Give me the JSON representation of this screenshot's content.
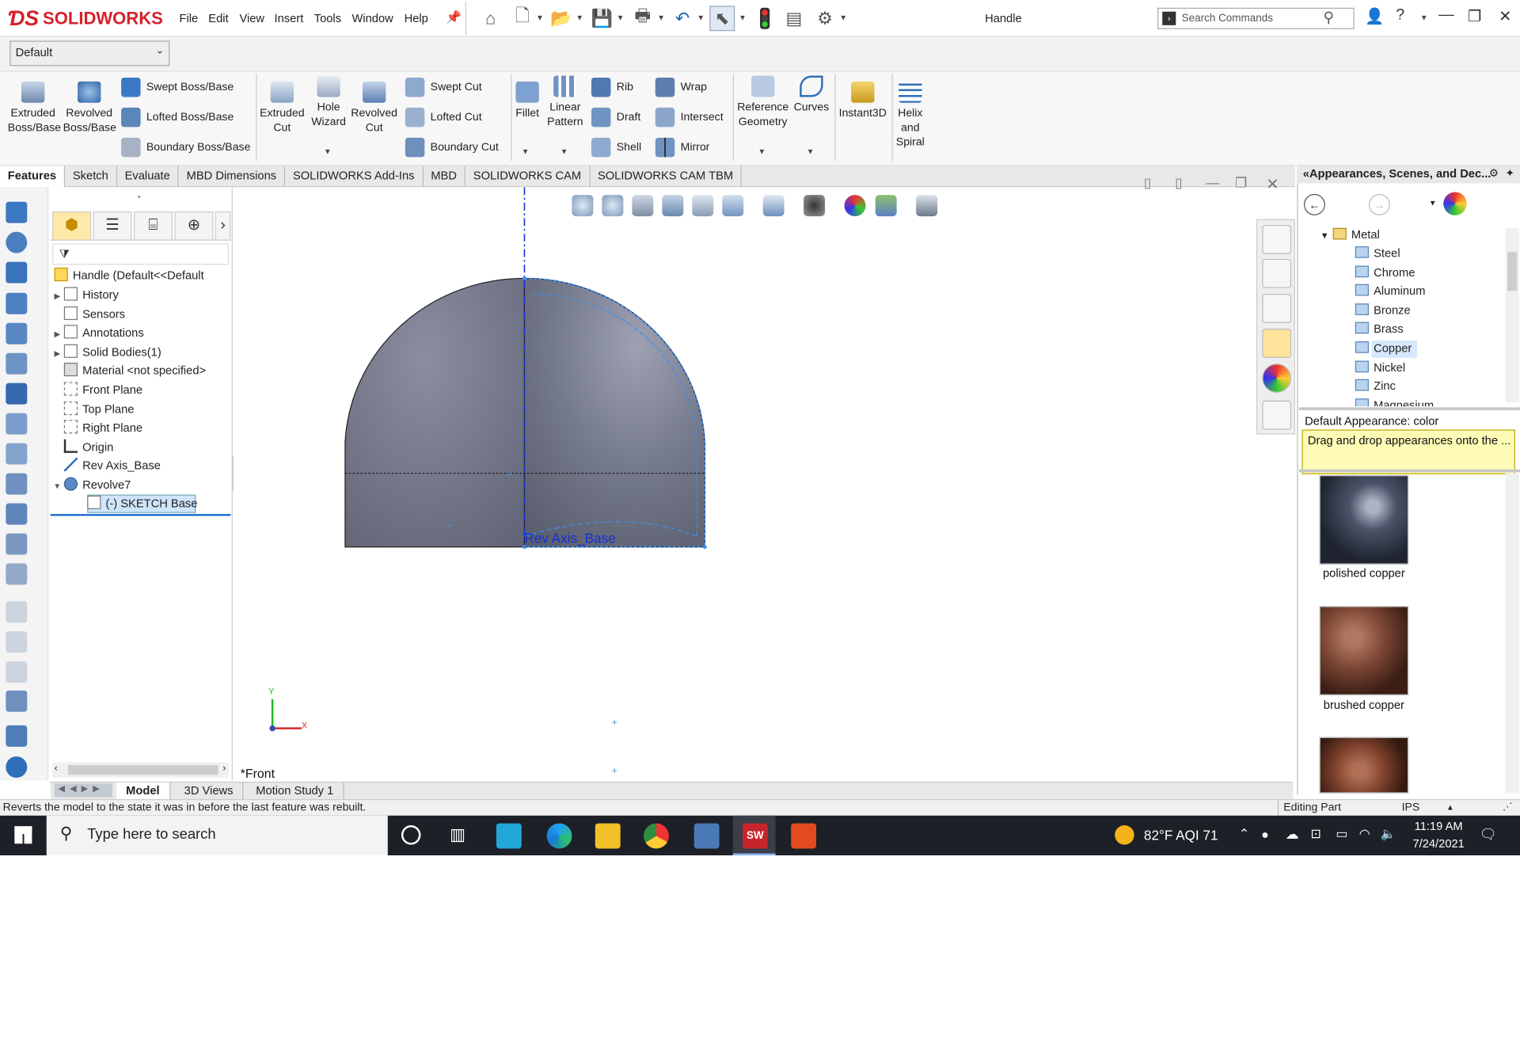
{
  "app": {
    "brand": "SOLIDWORKS",
    "doc_title": "Handle"
  },
  "menu": [
    "File",
    "Edit",
    "View",
    "Insert",
    "Tools",
    "Window",
    "Help"
  ],
  "search": {
    "placeholder": "Search Commands"
  },
  "config": {
    "value": "Default"
  },
  "ribbon": {
    "extruded_boss": "Extruded\nBoss/Base",
    "revolved_boss": "Revolved\nBoss/Base",
    "swept_boss": "Swept Boss/Base",
    "lofted_boss": "Lofted Boss/Base",
    "boundary_boss": "Boundary Boss/Base",
    "extruded_cut": "Extruded\nCut",
    "hole_wizard": "Hole\nWizard",
    "revolved_cut": "Revolved\nCut",
    "swept_cut": "Swept Cut",
    "lofted_cut": "Lofted Cut",
    "boundary_cut": "Boundary Cut",
    "fillet": "Fillet",
    "linear_pattern": "Linear\nPattern",
    "rib": "Rib",
    "draft": "Draft",
    "shell": "Shell",
    "wrap": "Wrap",
    "intersect": "Intersect",
    "mirror": "Mirror",
    "ref_geometry": "Reference\nGeometry",
    "curves": "Curves",
    "instant3d": "Instant3D",
    "helix": "Helix\nand\nSpiral"
  },
  "tabs": [
    "Features",
    "Sketch",
    "Evaluate",
    "MBD Dimensions",
    "SOLIDWORKS Add-Ins",
    "MBD",
    "SOLIDWORKS CAM",
    "SOLIDWORKS CAM TBM"
  ],
  "tree": {
    "root": "Handle  (Default<<Default",
    "items": [
      "History",
      "Sensors",
      "Annotations",
      "Solid Bodies(1)",
      "Material <not specified>",
      "Front Plane",
      "Top Plane",
      "Right Plane",
      "Origin",
      "Rev Axis_Base",
      "Revolve7",
      "(-) SKETCH Base"
    ]
  },
  "viewport": {
    "view_label": "*Front",
    "axis_label": "Rev Axis_Base",
    "triad_y": "Y",
    "triad_x": "X"
  },
  "right_pane": {
    "title": "«Appearances, Scenes, and Dec...",
    "folder": "Metal",
    "items": [
      "Steel",
      "Chrome",
      "Aluminum",
      "Bronze",
      "Brass",
      "Copper",
      "Nickel",
      "Zinc",
      "Magnesium"
    ],
    "default_appearance": "Default Appearance: color",
    "tip": "Drag and drop appearances onto the ...",
    "swatches": [
      "polished copper",
      "brushed copper"
    ]
  },
  "bottom_tabs": [
    "Model",
    "3D Views",
    "Motion Study 1"
  ],
  "status": {
    "message": "Reverts the model to the state it was in before the last feature was rebuilt.",
    "mode": "Editing Part",
    "units": "IPS"
  },
  "taskbar": {
    "search": "Type here to search",
    "weather": "82°F  AQI 71",
    "time": "11:19 AM",
    "date": "7/24/2021"
  },
  "colors": {
    "brand_red": "#d6202a",
    "accent_blue": "#1e6fd0",
    "part_gray": "#6b6f80",
    "taskbar": "#1d2027"
  },
  "icons": [
    "home-icon",
    "new-document-icon",
    "open-icon",
    "save-icon",
    "print-icon",
    "undo-icon",
    "select-icon",
    "traffic-light-icon",
    "options-icon",
    "settings-icon",
    "search-icon",
    "user-icon",
    "help-icon",
    "minimize-icon",
    "restore-icon",
    "close-icon"
  ]
}
